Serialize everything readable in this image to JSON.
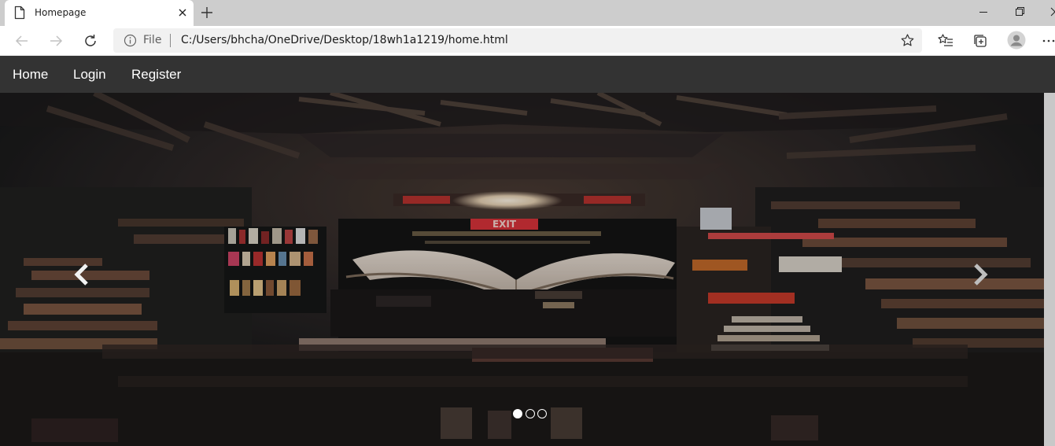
{
  "browser": {
    "tab_title": "Homepage",
    "omnibox": {
      "scheme_label": "File",
      "url": "C:/Users/bhcha/OneDrive/Desktop/18wh1a1219/home.html"
    }
  },
  "site_nav": {
    "items": [
      {
        "label": "Home"
      },
      {
        "label": "Login"
      },
      {
        "label": "Register"
      }
    ]
  },
  "carousel": {
    "slide_count": 3,
    "active_slide": 1,
    "image_subject": "open book floating in a dark library aisle with an EXIT sign",
    "sign_text": "EXIT",
    "prev_icon": "chevron-left-icon",
    "next_icon": "chevron-right-icon"
  },
  "colors": {
    "nav_bg": "#333333",
    "tab_strip_bg": "#cdcdcd",
    "exit_sign": "#d8323a"
  }
}
